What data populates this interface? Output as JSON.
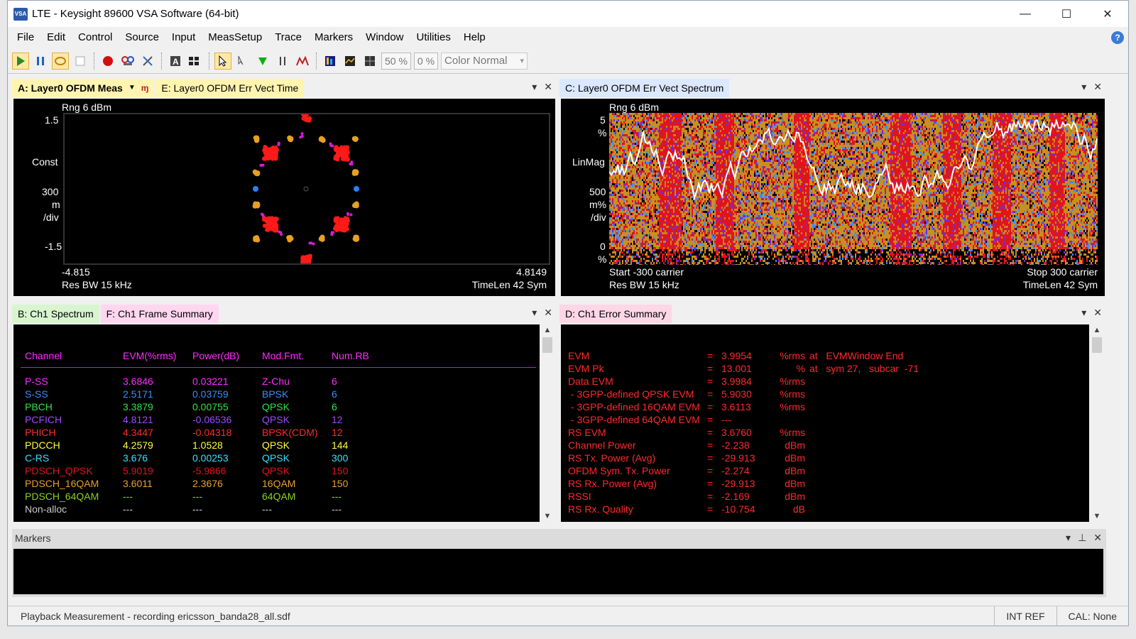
{
  "window": {
    "title": "LTE - Keysight 89600 VSA Software (64-bit)",
    "icon_text": "VSA"
  },
  "menu": [
    "File",
    "Edit",
    "Control",
    "Source",
    "Input",
    "MeasSetup",
    "Trace",
    "Markers",
    "Window",
    "Utilities",
    "Help"
  ],
  "toolbar": {
    "field_50": "50 %",
    "field_0": "0 %",
    "color_select": "Color Normal"
  },
  "paneA": {
    "tab_a": "A: Layer0 OFDM Meas",
    "tab_e": "E: Layer0 OFDM Err Vect Time",
    "rng": "Rng 6 dBm",
    "ytop": "1.5",
    "ylabel": "Const",
    "scale1": "300",
    "scale2": "m",
    "scale3": "/div",
    "ybot": "-1.5",
    "xleft": "-4.815",
    "xright": "4.8149",
    "resbw": "Res BW 15 kHz",
    "timelen": "TimeLen 42  Sym"
  },
  "paneC": {
    "tab_c": "C: Layer0 OFDM Err Vect Spectrum",
    "rng": "Rng 6 dBm",
    "ytop": "5",
    "ytop_unit": "%",
    "ylabel": "LinMag",
    "scale1": "500",
    "scale2": "m%",
    "scale3": "/div",
    "ybot": "0",
    "ybot_unit": "%",
    "start": "Start -300  carrier",
    "stop": "Stop 300  carrier",
    "resbw": "Res BW 15 kHz",
    "timelen": "TimeLen 42  Sym"
  },
  "paneF": {
    "tab_b": "B: Ch1 Spectrum",
    "tab_f": "F: Ch1 Frame Summary",
    "headers": [
      "Channel",
      "EVM(%rms)",
      "Power(dB)",
      "Mod.Fmt.",
      "Num.RB"
    ],
    "rows": [
      {
        "cells": [
          "P-SS",
          "3.6846",
          "0.03221",
          "Z-Chu",
          "6"
        ],
        "color": "#ff2bff"
      },
      {
        "cells": [
          "S-SS",
          "2.5171",
          "0.03759",
          "BPSK",
          "6"
        ],
        "color": "#3c8cff"
      },
      {
        "cells": [
          "PBCH",
          "3.3879",
          "0.00755",
          "QPSK",
          "6"
        ],
        "color": "#2fe04a"
      },
      {
        "cells": [
          "PCFICH",
          "4.8121",
          "-0.06536",
          "QPSK",
          "12"
        ],
        "color": "#9a4cff"
      },
      {
        "cells": [
          "PHICH",
          "4.3447",
          "-0.04318",
          "BPSK(CDM)",
          "12"
        ],
        "color": "#ff2a2a"
      },
      {
        "cells": [
          "PDCCH",
          "4.2579",
          "1.0528",
          "QPSK",
          "144"
        ],
        "color": "#ffff3a"
      },
      {
        "cells": [
          "C-RS",
          "3.676",
          "0.00253",
          "QPSK",
          "300"
        ],
        "color": "#34e1ff"
      },
      {
        "cells": [
          "PDSCH_QPSK",
          "5.9019",
          "-5.9866",
          "QPSK",
          "150"
        ],
        "color": "#e0141e"
      },
      {
        "cells": [
          "PDSCH_16QAM",
          "3.6011",
          "2.3676",
          "16QAM",
          "150"
        ],
        "color": "#e8a030"
      },
      {
        "cells": [
          "PDSCH_64QAM",
          "---",
          "---",
          "64QAM",
          "---"
        ],
        "color": "#8ad21e"
      },
      {
        "cells": [
          "Non-alloc",
          "---",
          "---",
          "---",
          "---"
        ],
        "color": "#c8c8c8"
      }
    ],
    "header_colors": [
      "#ff2bff",
      "#ff2bff",
      "#ff2bff",
      "#ff2bff",
      "#ff2bff"
    ]
  },
  "paneD": {
    "tab_d": "D: Ch1 Error Summary",
    "rows": [
      {
        "name": "EVM",
        "eq": "=",
        "val": "3.9954",
        "unit": "%rms",
        "extra": "at   EVMWindow End"
      },
      {
        "name": "EVM Pk",
        "eq": "=",
        "val": "13.001",
        "unit": "%",
        "extra": "at   sym 27,   subcar  -71"
      },
      {
        "name": "Data EVM",
        "eq": "=",
        "val": "3.9984",
        "unit": "%rms",
        "extra": ""
      },
      {
        "name": " - 3GPP-defined QPSK EVM",
        "eq": "=",
        "val": "5.9030",
        "unit": "%rms",
        "extra": ""
      },
      {
        "name": " - 3GPP-defined 16QAM EVM",
        "eq": "=",
        "val": "3.6113",
        "unit": "%rms",
        "extra": ""
      },
      {
        "name": " - 3GPP-defined 64QAM EVM",
        "eq": "=",
        "val": "---",
        "unit": "",
        "extra": ""
      },
      {
        "name": "RS EVM",
        "eq": "=",
        "val": "3.6760",
        "unit": "%rms",
        "extra": ""
      },
      {
        "name": "Channel Power",
        "eq": "=",
        "val": "-2.238",
        "unit": "dBm",
        "extra": ""
      },
      {
        "name": "RS Tx. Power (Avg)",
        "eq": "=",
        "val": "-29.913",
        "unit": "dBm",
        "extra": ""
      },
      {
        "name": "OFDM Sym. Tx. Power",
        "eq": "=",
        "val": "-2.274",
        "unit": "dBm",
        "extra": ""
      },
      {
        "name": "RS Rx. Power (Avg)",
        "eq": "=",
        "val": "-29.913",
        "unit": "dBm",
        "extra": ""
      },
      {
        "name": "RSSI",
        "eq": "=",
        "val": "-2.169",
        "unit": "dBm",
        "extra": ""
      },
      {
        "name": "RS Rx. Quality",
        "eq": "=",
        "val": "-10.754",
        "unit": "dB",
        "extra": ""
      }
    ],
    "text_color": "#ff2a2a"
  },
  "markers": {
    "title": "Markers"
  },
  "status": {
    "main": "Playback Measurement - recording ericsson_banda28_all.sdf",
    "intref": "INT REF",
    "cal": "CAL: None"
  },
  "colors": {
    "tab_a_bg": "#fff4b0",
    "tab_c_bg": "#dbe8ff",
    "tab_b_bg": "#d8f5d0",
    "tab_f_bg": "#ffd6f0",
    "tab_d_bg": "#ffd6e6",
    "constellation_red": "#ff1a1a",
    "constellation_orange": "#e8a020",
    "constellation_blue": "#2a7fff",
    "constellation_magenta": "#d21ed2"
  }
}
